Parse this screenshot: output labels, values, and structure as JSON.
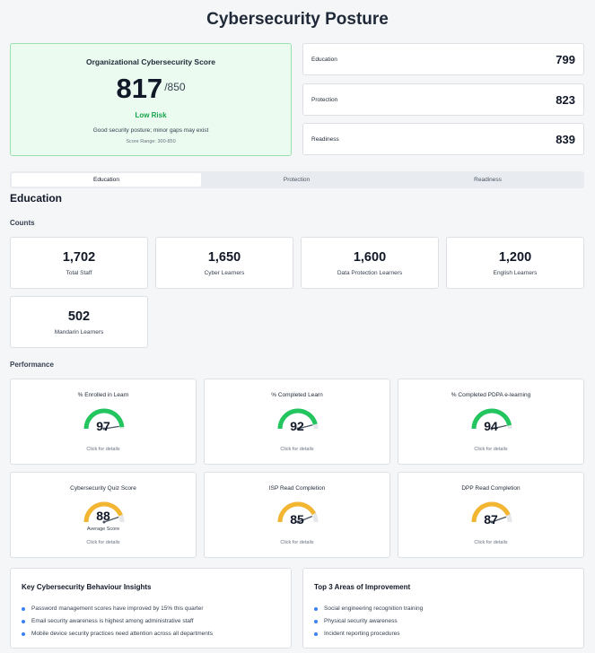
{
  "page": {
    "title": "Cybersecurity Posture"
  },
  "overall": {
    "heading": "Organizational Cybersecurity Score",
    "score": "817",
    "max": "/850",
    "risk": "Low Risk",
    "description": "Good security posture; minor gaps may exist",
    "range": "Score Range: 300-850",
    "color": "#16a34a"
  },
  "metrics": [
    {
      "label": "Education",
      "value": "799"
    },
    {
      "label": "Protection",
      "value": "823"
    },
    {
      "label": "Readiness",
      "value": "839"
    }
  ],
  "tabs": [
    {
      "label": "Education",
      "active": true
    },
    {
      "label": "Protection",
      "active": false
    },
    {
      "label": "Readiness",
      "active": false
    }
  ],
  "section": {
    "title": "Education",
    "counts_title": "Counts",
    "performance_title": "Performance"
  },
  "counts": [
    {
      "value": "1,702",
      "label": "Total Staff"
    },
    {
      "value": "1,650",
      "label": "Cyber Learners"
    },
    {
      "value": "1,600",
      "label": "Data Protection Learners"
    },
    {
      "value": "1,200",
      "label": "English Learners"
    },
    {
      "value": "502",
      "label": "Mandarin Learners"
    }
  ],
  "gauges": [
    {
      "title": "% Enrolled in Learn",
      "value": "97",
      "level": 0.97,
      "color": "#22c55e",
      "sub": "",
      "click": "Click for details"
    },
    {
      "title": "% Completed Learn",
      "value": "92",
      "level": 0.92,
      "color": "#22c55e",
      "sub": "",
      "click": "Click for details"
    },
    {
      "title": "% Completed PDPA e-learning",
      "value": "94",
      "level": 0.94,
      "color": "#22c55e",
      "sub": "",
      "click": "Click for details"
    },
    {
      "title": "Cybersecurity Quiz Score",
      "value": "88",
      "level": 0.88,
      "color": "#f2b632",
      "sub": "Average Score",
      "click": "Click for details"
    },
    {
      "title": "ISP Read Completion",
      "value": "85",
      "level": 0.85,
      "color": "#f2b632",
      "sub": "",
      "click": "Click for details"
    },
    {
      "title": "DPP Read Completion",
      "value": "87",
      "level": 0.87,
      "color": "#f2b632",
      "sub": "",
      "click": "Click for details"
    }
  ],
  "insights": {
    "title": "Key Cybersecurity Behaviour Insights",
    "items": [
      "Password management scores have improved by 15% this quarter",
      "Email security awareness is highest among administrative staff",
      "Mobile device security practices need attention across all departments"
    ]
  },
  "improvements": {
    "title": "Top 3 Areas of Improvement",
    "items": [
      "Social engineering recognition training",
      "Physical security awareness",
      "Incident reporting procedures"
    ]
  }
}
